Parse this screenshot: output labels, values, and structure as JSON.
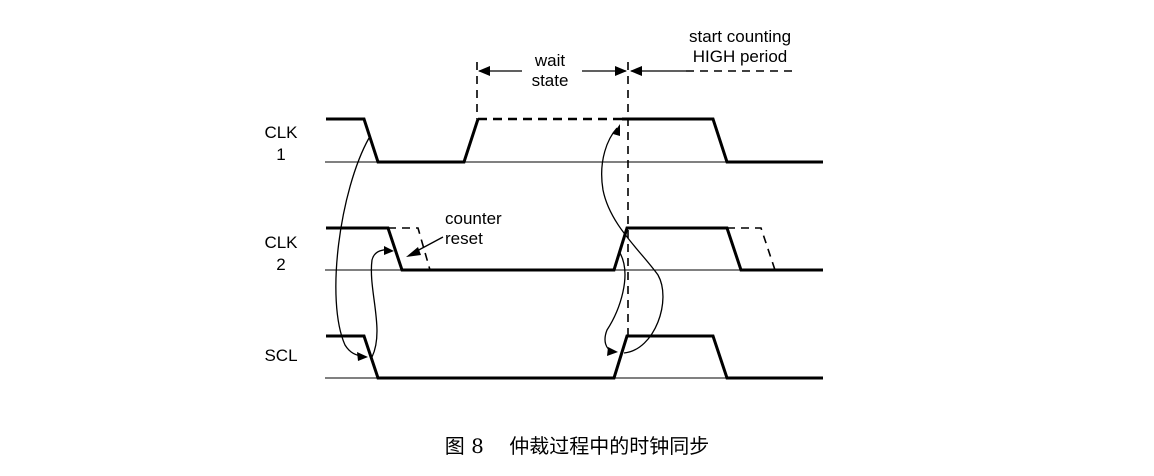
{
  "signals": {
    "clk1": {
      "line1": "CLK",
      "line2": "1"
    },
    "clk2": {
      "line1": "CLK",
      "line2": "2"
    },
    "scl": {
      "label": "SCL"
    }
  },
  "annotations": {
    "wait_state": {
      "line1": "wait",
      "line2": "state"
    },
    "start_counting": {
      "line1": "start counting",
      "line2": "HIGH period"
    },
    "counter_reset": {
      "line1": "counter",
      "line2": "reset"
    }
  },
  "caption": "图 8    仲裁过程中的时钟同步"
}
